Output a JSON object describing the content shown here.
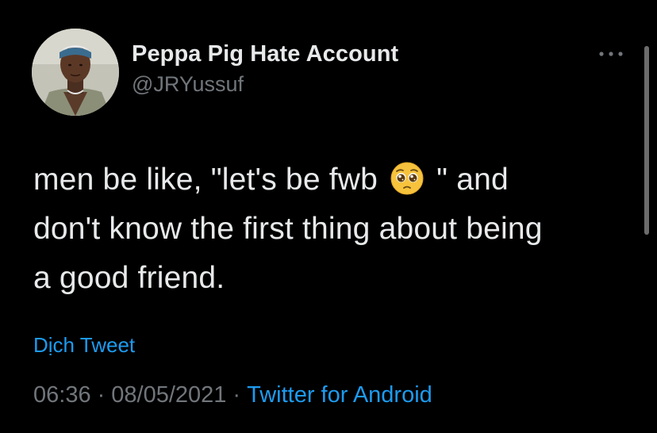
{
  "author": {
    "display_name": "Peppa Pig Hate Account",
    "handle": "@JRYussuf"
  },
  "tweet": {
    "lines": [
      [
        "men be like, \"let's be fwb",
        "\" and"
      ],
      "don't know the first thing about being",
      "a good friend."
    ],
    "emoji": "pleading-face-icon"
  },
  "translate_label": "Dịch Tweet",
  "meta": {
    "time": "06:36",
    "date": "08/05/2021",
    "separator": "·",
    "source": "Twitter for Android"
  },
  "colors": {
    "background": "#000000",
    "text": "#e7e9ea",
    "secondary": "#71767b",
    "link": "#1d9bf0"
  }
}
